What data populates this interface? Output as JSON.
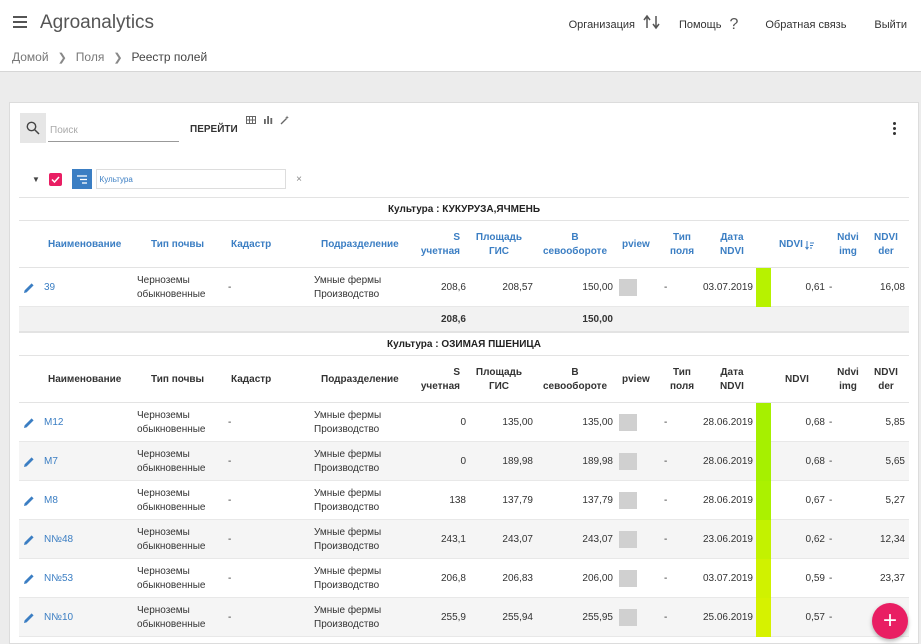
{
  "app": {
    "title": "Agroanalytics"
  },
  "top_actions": [
    {
      "label": "Организация",
      "icon": "swap-icon"
    },
    {
      "label": "Помощь",
      "icon": "help-icon"
    },
    {
      "label": "Обратная связь",
      "icon": ""
    },
    {
      "label": "Выйти",
      "icon": ""
    }
  ],
  "breadcrumb": [
    "Домой",
    "Поля",
    "Реестр полей"
  ],
  "toolbar": {
    "search_placeholder": "Поиск",
    "go_label": "ПЕРЕЙТИ"
  },
  "grouping": {
    "chip_label": "Культура",
    "close_glyph": "×"
  },
  "columns": [
    "Наименование",
    "Тип почвы",
    "Кадастр",
    "Подразделение",
    "S учетная",
    "Площадь ГИС",
    "В севообороте",
    "pview",
    "Тип поля",
    "Дата NDVI",
    "NDVI",
    "Ndvi img",
    "NDVI der"
  ],
  "groups": [
    {
      "title": "Культура : КУКУРУЗА,ЯЧМЕНЬ",
      "rows": [
        {
          "name": "39",
          "soil": "Черноземы обыкновенные",
          "cadastre": "-",
          "division": "Умные фермы Производство",
          "s_account": "208,6",
          "area_gis": "208,57",
          "rotation": "150,00",
          "field_type": "-",
          "ndvi_date": "03.07.2019",
          "ndvi_color": "#b7f200",
          "ndvi": "0,61",
          "ndvi_img": "-",
          "ndvi_der": "16,08"
        }
      ],
      "totals": {
        "s_account": "208,6",
        "rotation": "150,00"
      }
    },
    {
      "title": "Культура : ОЗИМАЯ ПШЕНИЦА",
      "rows": [
        {
          "name": "M12",
          "soil": "Черноземы обыкновенные",
          "cadastre": "-",
          "division": "Умные фермы Производство",
          "s_account": "0",
          "area_gis": "135,00",
          "rotation": "135,00",
          "field_type": "-",
          "ndvi_date": "28.06.2019",
          "ndvi_color": "#a6f000",
          "ndvi": "0,68",
          "ndvi_img": "-",
          "ndvi_der": "5,85"
        },
        {
          "name": "M7",
          "soil": "Черноземы обыкновенные",
          "cadastre": "-",
          "division": "Умные фермы Производство",
          "s_account": "0",
          "area_gis": "189,98",
          "rotation": "189,98",
          "field_type": "-",
          "ndvi_date": "28.06.2019",
          "ndvi_color": "#a6f000",
          "ndvi": "0,68",
          "ndvi_img": "-",
          "ndvi_der": "5,65"
        },
        {
          "name": "M8",
          "soil": "Черноземы обыкновенные",
          "cadastre": "-",
          "division": "Умные фермы Производство",
          "s_account": "138",
          "area_gis": "137,79",
          "rotation": "137,79",
          "field_type": "-",
          "ndvi_date": "28.06.2019",
          "ndvi_color": "#abf100",
          "ndvi": "0,67",
          "ndvi_img": "-",
          "ndvi_der": "5,27"
        },
        {
          "name": "N№48",
          "soil": "Черноземы обыкновенные",
          "cadastre": "-",
          "division": "Умные фермы Производство",
          "s_account": "243,1",
          "area_gis": "243,07",
          "rotation": "243,07",
          "field_type": "-",
          "ndvi_date": "23.06.2019",
          "ndvi_color": "#c3f200",
          "ndvi": "0,62",
          "ndvi_img": "-",
          "ndvi_der": "12,34"
        },
        {
          "name": "N№53",
          "soil": "Черноземы обыкновенные",
          "cadastre": "-",
          "division": "Умные фермы Производство",
          "s_account": "206,8",
          "area_gis": "206,83",
          "rotation": "206,00",
          "field_type": "-",
          "ndvi_date": "03.07.2019",
          "ndvi_color": "#d0f200",
          "ndvi": "0,59",
          "ndvi_img": "-",
          "ndvi_der": "23,37"
        },
        {
          "name": "N№10",
          "soil": "Черноземы обыкновенные",
          "cadastre": "-",
          "division": "Умные фермы Производство",
          "s_account": "255,9",
          "area_gis": "255,94",
          "rotation": "255,95",
          "field_type": "-",
          "ndvi_date": "25.06.2019",
          "ndvi_color": "#d6f200",
          "ndvi": "0,57",
          "ndvi_img": "-",
          "ndvi_der": ""
        }
      ]
    }
  ],
  "fab": {
    "label": "+"
  }
}
